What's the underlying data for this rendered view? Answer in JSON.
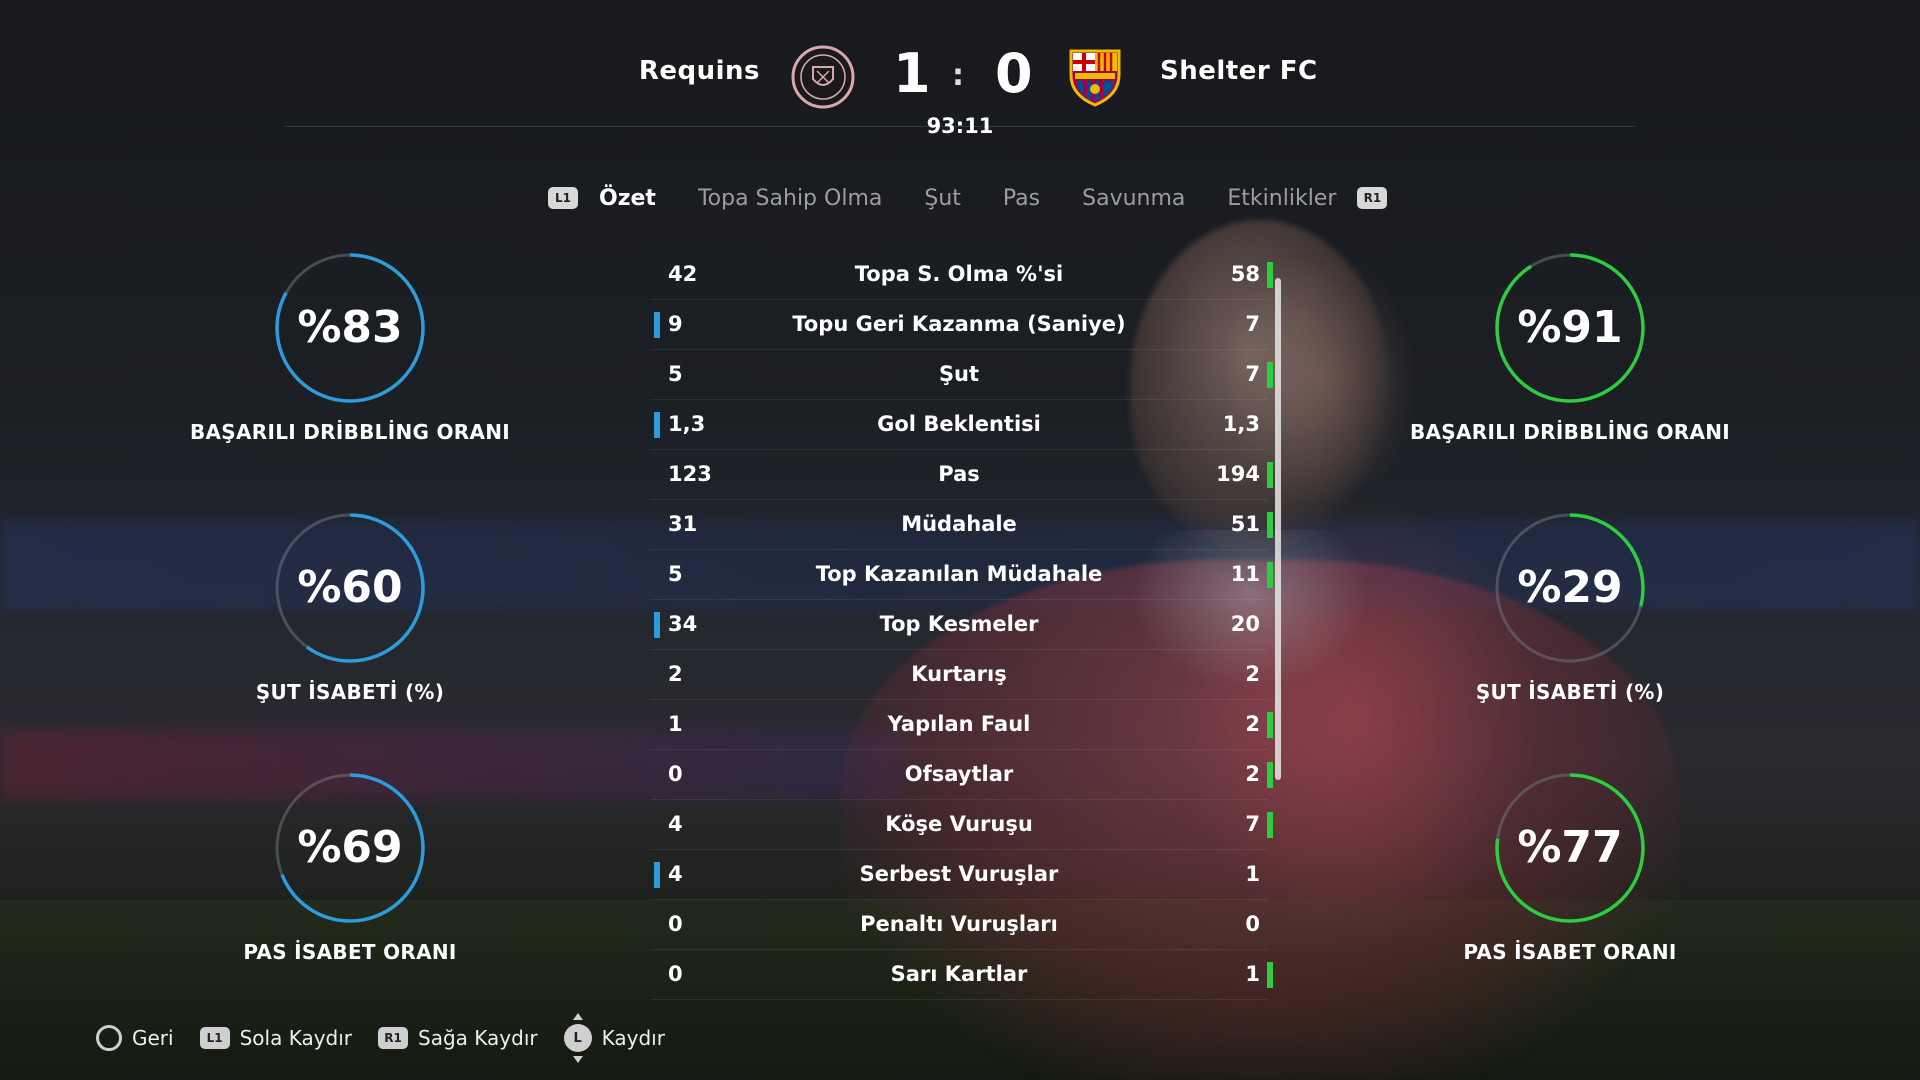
{
  "match": {
    "home_team": "Requins",
    "away_team": "Shelter FC",
    "home_score": "1",
    "away_score": "0",
    "separator": ":",
    "clock": "93:11",
    "home_color": "#2d9cdb",
    "away_color": "#2ecc40"
  },
  "tabs": {
    "prev_button": "L1",
    "next_button": "R1",
    "items": [
      {
        "label": "Özet",
        "active": true
      },
      {
        "label": "Topa Sahip Olma",
        "active": false
      },
      {
        "label": "Şut",
        "active": false
      },
      {
        "label": "Pas",
        "active": false
      },
      {
        "label": "Savunma",
        "active": false
      },
      {
        "label": "Etkinlikler",
        "active": false
      }
    ]
  },
  "stats": [
    {
      "label": "Topa S. Olma %'si",
      "home": "42",
      "away": "58",
      "lead": "away"
    },
    {
      "label": "Topu Geri Kazanma (Saniye)",
      "home": "9",
      "away": "7",
      "lead": "home"
    },
    {
      "label": "Şut",
      "home": "5",
      "away": "7",
      "lead": "away"
    },
    {
      "label": "Gol Beklentisi",
      "home": "1,3",
      "away": "1,3",
      "lead": "home"
    },
    {
      "label": "Pas",
      "home": "123",
      "away": "194",
      "lead": "away"
    },
    {
      "label": "Müdahale",
      "home": "31",
      "away": "51",
      "lead": "away"
    },
    {
      "label": "Top Kazanılan Müdahale",
      "home": "5",
      "away": "11",
      "lead": "away"
    },
    {
      "label": "Top Kesmeler",
      "home": "34",
      "away": "20",
      "lead": "home"
    },
    {
      "label": "Kurtarış",
      "home": "2",
      "away": "2",
      "lead": "none"
    },
    {
      "label": "Yapılan Faul",
      "home": "1",
      "away": "2",
      "lead": "away"
    },
    {
      "label": "Ofsaytlar",
      "home": "0",
      "away": "2",
      "lead": "away"
    },
    {
      "label": "Köşe Vuruşu",
      "home": "4",
      "away": "7",
      "lead": "away"
    },
    {
      "label": "Serbest Vuruşlar",
      "home": "4",
      "away": "1",
      "lead": "home"
    },
    {
      "label": "Penaltı Vuruşları",
      "home": "0",
      "away": "0",
      "lead": "none"
    },
    {
      "label": "Sarı Kartlar",
      "home": "0",
      "away": "1",
      "lead": "away"
    }
  ],
  "home_circles": [
    {
      "value_text": "%83",
      "fraction": 0.83,
      "caption": "BAŞARILI DRİBBLİNG ORANI"
    },
    {
      "value_text": "%60",
      "fraction": 0.6,
      "caption": "ŞUT İSABETİ (%)"
    },
    {
      "value_text": "%69",
      "fraction": 0.69,
      "caption": "PAS İSABET ORANI"
    }
  ],
  "away_circles": [
    {
      "value_text": "%91",
      "fraction": 0.91,
      "caption": "BAŞARILI DRİBBLİNG ORANI"
    },
    {
      "value_text": "%29",
      "fraction": 0.29,
      "caption": "ŞUT İSABETİ (%)"
    },
    {
      "value_text": "%77",
      "fraction": 0.77,
      "caption": "PAS İSABET ORANI"
    }
  ],
  "footer": {
    "back": "Geri",
    "scroll_left_button": "L1",
    "scroll_left": "Sola Kaydır",
    "scroll_right_button": "R1",
    "scroll_right": "Sağa Kaydır",
    "stick_button": "L",
    "scroll": "Kaydır"
  },
  "icons": {
    "home_crest": "shield-crest-icon",
    "away_crest": "club-crest-icon",
    "back": "circle-button-icon"
  }
}
